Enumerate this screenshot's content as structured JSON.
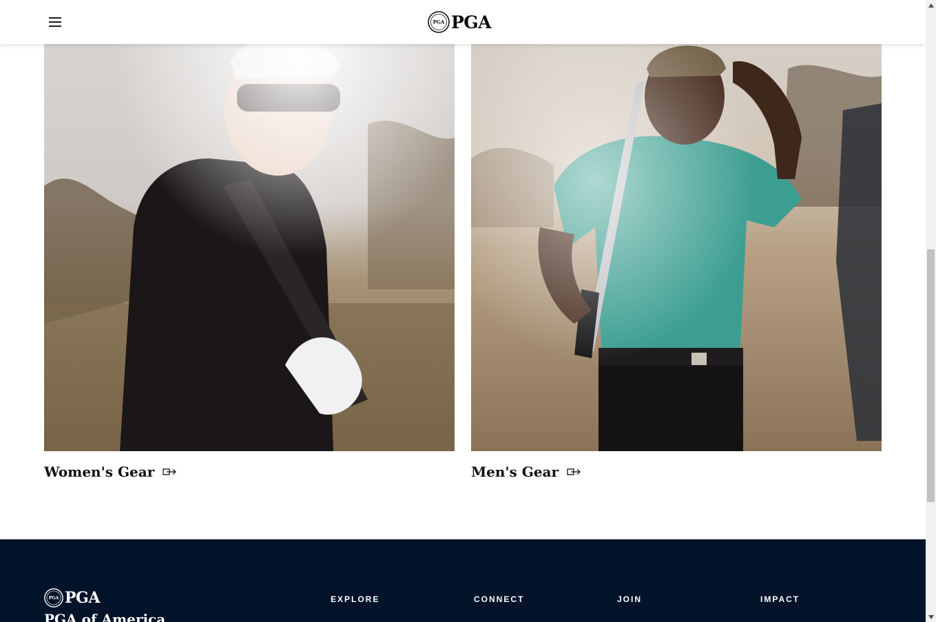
{
  "header": {
    "logo_text": "PGA",
    "logo_badge_text": "PGA",
    "menu_icon": "hamburger-menu-icon"
  },
  "cards": [
    {
      "title": "Women's Gear",
      "icon": "external-arrow-icon"
    },
    {
      "title": "Men's Gear",
      "icon": "external-arrow-icon"
    }
  ],
  "footer": {
    "logo_text": "PGA",
    "logo_badge_text": "PGA",
    "org_name": "PGA of America",
    "columns": [
      "EXPLORE",
      "CONNECT",
      "JOIN",
      "IMPACT"
    ]
  },
  "colors": {
    "footer_bg": "#03132a",
    "header_bg": "#ffffff",
    "text_dark": "#111111"
  }
}
